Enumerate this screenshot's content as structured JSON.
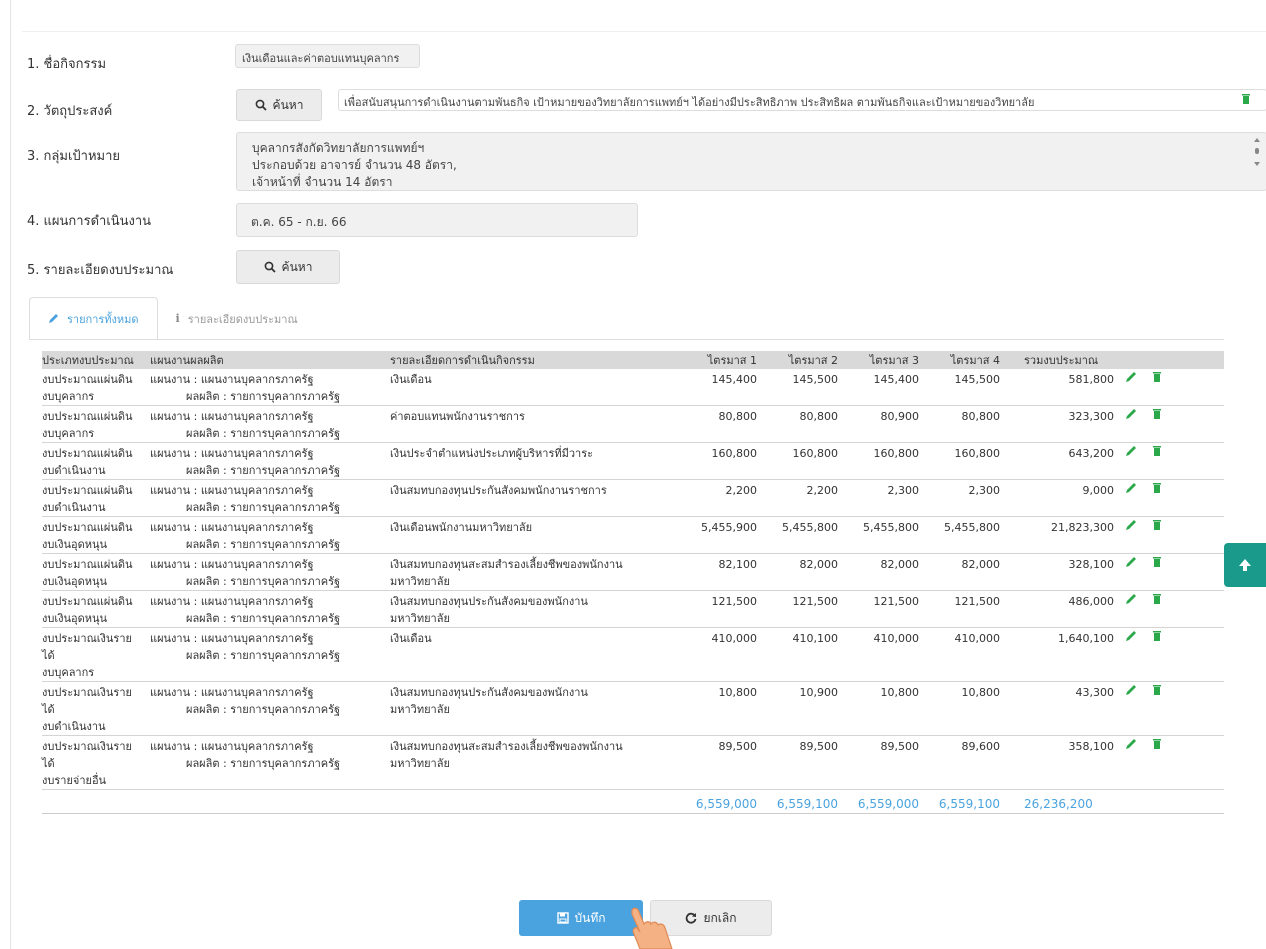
{
  "form": {
    "activity_label": "1. ชื่อกิจกรรม",
    "activity_value": "เงินเดือนและค่าตอบแทนบุคลากร",
    "objective_label": "2. วัตถุประสงค์",
    "objective_search": "ค้นหา",
    "objective_value": "เพื่อสนับสนุนการดำเนินงานตามพันธกิจ เป้าหมายของวิทยาลัยการแพทย์ฯ ได้อย่างมีประสิทธิภาพ ประสิทธิผล ตามพันธกิจและเป้าหมายของวิทยาลัย",
    "target_label": "3. กลุ่มเป้าหมาย",
    "target_line1": "บุคลากรสังกัดวิทยาลัยการแพทย์ฯ",
    "target_line2": "ประกอบด้วย อาจารย์ จำนวน 48 อัตรา,",
    "target_line3": "เจ้าหน้าที่ จำนวน 14 อัตรา",
    "plan_label": "4. แผนการดำเนินงาน",
    "plan_value": "ต.ค. 65 - ก.ย. 66",
    "budget_label": "5. รายละเอียดงบประมาณ",
    "budget_search": "ค้นหา"
  },
  "tabs": {
    "all": "รายการทั้งหมด",
    "detail": "รายละเอียดงบประมาณ"
  },
  "table": {
    "headers": {
      "type": "ประเภทงบประมาณ",
      "plan": "แผนงานผลผลิต",
      "detail": "รายละเอียดการดำเนินกิจกรรม",
      "q1": "ไตรมาส 1",
      "q2": "ไตรมาส 2",
      "q3": "ไตรมาส 3",
      "q4": "ไตรมาส 4",
      "total": "รวมงบประมาณ"
    },
    "rows": [
      {
        "type1": "งบประมาณแผ่นดิน",
        "type2": "งบบุคลากร",
        "type3": "",
        "plan1": "แผนงาน : แผนงานบุคลากรภาครัฐ",
        "plan2": "ผลผลิต : รายการบุคลากรภาครัฐ",
        "detail1": "เงินเดือน",
        "detail2": "",
        "q1": "145,400",
        "q2": "145,500",
        "q3": "145,400",
        "q4": "145,500",
        "total": "581,800"
      },
      {
        "type1": "งบประมาณแผ่นดิน",
        "type2": "งบบุคลากร",
        "type3": "",
        "plan1": "แผนงาน : แผนงานบุคลากรภาครัฐ",
        "plan2": "ผลผลิต : รายการบุคลากรภาครัฐ",
        "detail1": "ค่าตอบแทนพนักงานราชการ",
        "detail2": "",
        "q1": "80,800",
        "q2": "80,800",
        "q3": "80,900",
        "q4": "80,800",
        "total": "323,300"
      },
      {
        "type1": "งบประมาณแผ่นดิน",
        "type2": "งบดำเนินงาน",
        "type3": "",
        "plan1": "แผนงาน : แผนงานบุคลากรภาครัฐ",
        "plan2": "ผลผลิต : รายการบุคลากรภาครัฐ",
        "detail1": "เงินประจำตำแหน่งประเภทผู้บริหารที่มีวาระ",
        "detail2": "",
        "q1": "160,800",
        "q2": "160,800",
        "q3": "160,800",
        "q4": "160,800",
        "total": "643,200"
      },
      {
        "type1": "งบประมาณแผ่นดิน",
        "type2": "งบดำเนินงาน",
        "type3": "",
        "plan1": "แผนงาน : แผนงานบุคลากรภาครัฐ",
        "plan2": "ผลผลิต : รายการบุคลากรภาครัฐ",
        "detail1": "เงินสมทบกองทุนประกันสังคมพนักงานราชการ",
        "detail2": "",
        "q1": "2,200",
        "q2": "2,200",
        "q3": "2,300",
        "q4": "2,300",
        "total": "9,000"
      },
      {
        "type1": "งบประมาณแผ่นดิน",
        "type2": "งบเงินอุดหนุน",
        "type3": "",
        "plan1": "แผนงาน : แผนงานบุคลากรภาครัฐ",
        "plan2": "ผลผลิต : รายการบุคลากรภาครัฐ",
        "detail1": "เงินเดือนพนักงานมหาวิทยาลัย",
        "detail2": "",
        "q1": "5,455,900",
        "q2": "5,455,800",
        "q3": "5,455,800",
        "q4": "5,455,800",
        "total": "21,823,300"
      },
      {
        "type1": "งบประมาณแผ่นดิน",
        "type2": "งบเงินอุดหนุน",
        "type3": "",
        "plan1": "แผนงาน : แผนงานบุคลากรภาครัฐ",
        "plan2": "ผลผลิต : รายการบุคลากรภาครัฐ",
        "detail1": "เงินสมทบกองทุนสะสมสำรองเลี้ยงชีพของพนักงาน",
        "detail2": "มหาวิทยาลัย",
        "q1": "82,100",
        "q2": "82,000",
        "q3": "82,000",
        "q4": "82,000",
        "total": "328,100"
      },
      {
        "type1": "งบประมาณแผ่นดิน",
        "type2": "งบเงินอุดหนุน",
        "type3": "",
        "plan1": "แผนงาน : แผนงานบุคลากรภาครัฐ",
        "plan2": "ผลผลิต : รายการบุคลากรภาครัฐ",
        "detail1": "เงินสมทบกองทุนประกันสังคมของพนักงาน",
        "detail2": "มหาวิทยาลัย",
        "q1": "121,500",
        "q2": "121,500",
        "q3": "121,500",
        "q4": "121,500",
        "total": "486,000"
      },
      {
        "type1": "งบประมาณเงินราย",
        "type2": "ได้",
        "type3": "งบบุคลากร",
        "plan1": "แผนงาน : แผนงานบุคลากรภาครัฐ",
        "plan2": "ผลผลิต : รายการบุคลากรภาครัฐ",
        "detail1": "เงินเดือน",
        "detail2": "",
        "q1": "410,000",
        "q2": "410,100",
        "q3": "410,000",
        "q4": "410,000",
        "total": "1,640,100"
      },
      {
        "type1": "งบประมาณเงินราย",
        "type2": "ได้",
        "type3": "งบดำเนินงาน",
        "plan1": "แผนงาน : แผนงานบุคลากรภาครัฐ",
        "plan2": "ผลผลิต : รายการบุคลากรภาครัฐ",
        "detail1": "เงินสมทบกองทุนประกันสังคมของพนักงาน",
        "detail2": "มหาวิทยาลัย",
        "q1": "10,800",
        "q2": "10,900",
        "q3": "10,800",
        "q4": "10,800",
        "total": "43,300"
      },
      {
        "type1": "งบประมาณเงินราย",
        "type2": "ได้",
        "type3": "งบรายจ่ายอื่น",
        "plan1": "แผนงาน : แผนงานบุคลากรภาครัฐ",
        "plan2": "ผลผลิต : รายการบุคลากรภาครัฐ",
        "detail1": "เงินสมทบกองทุนสะสมสำรองเลี้ยงชีพของพนักงาน",
        "detail2": "มหาวิทยาลัย",
        "q1": "89,500",
        "q2": "89,500",
        "q3": "89,500",
        "q4": "89,600",
        "total": "358,100"
      }
    ],
    "totals": {
      "q1": "6,559,000",
      "q2": "6,559,100",
      "q3": "6,559,000",
      "q4": "6,559,100",
      "total": "26,236,200"
    }
  },
  "buttons": {
    "save": "บันทึก",
    "cancel": "ยกเลิก"
  },
  "colors": {
    "accent": "#4aa3df",
    "scroll_top": "#1a9a8a",
    "edit_icon": "#2aa84a",
    "delete_icon": "#2aa84a"
  },
  "icons": [
    "search-icon",
    "pencil-icon",
    "info-icon",
    "edit-icon",
    "trash-icon",
    "save-icon",
    "refresh-icon",
    "arrow-up-icon",
    "hand-pointer-icon"
  ]
}
